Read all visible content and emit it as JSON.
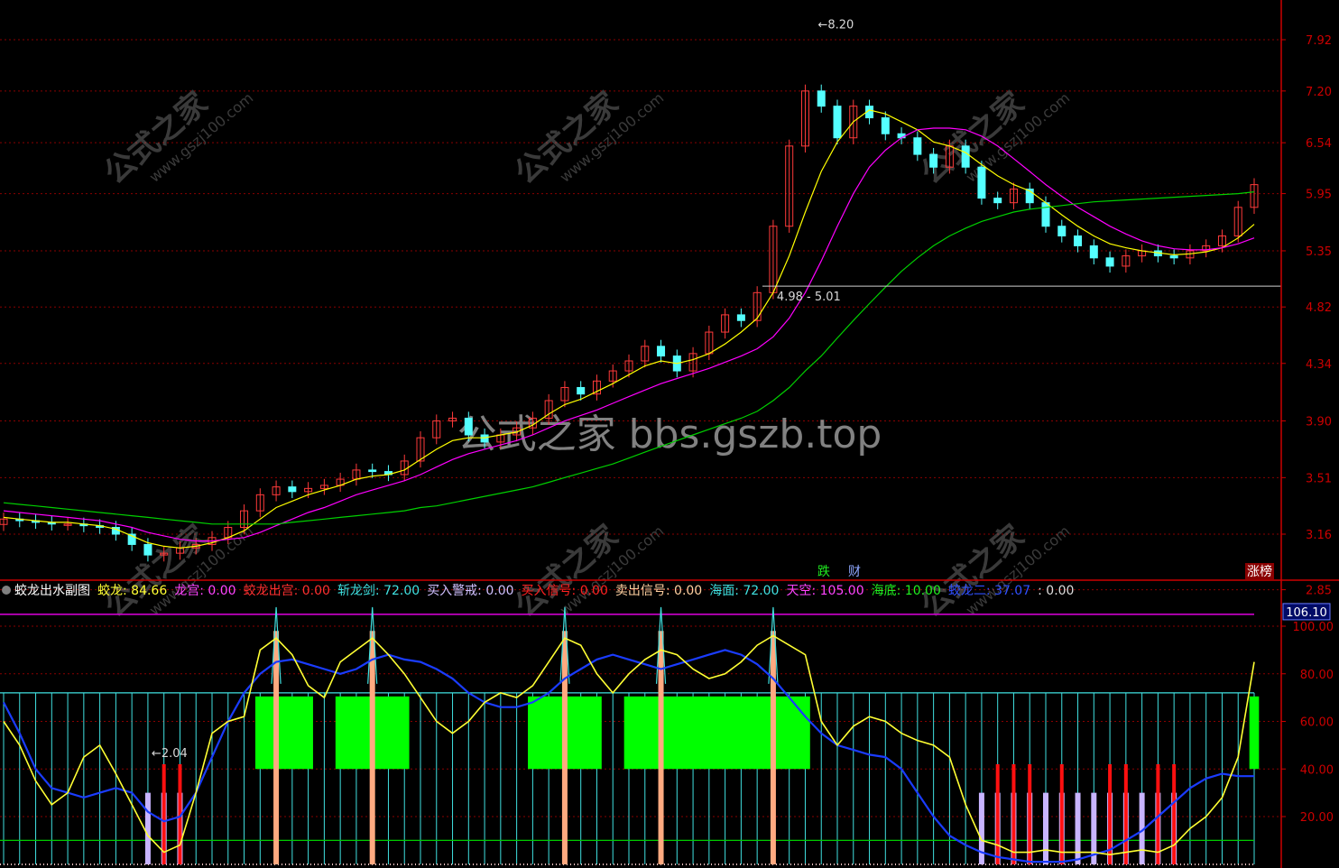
{
  "colors": {
    "background": "#000000",
    "grid": "#8a0000",
    "axis": "#cc0000",
    "up_candle": "#ff3a3a",
    "down_candle": "#54ffff",
    "ma5": "#ffffff",
    "ma10": "#ffff00",
    "ma20": "#ff00ff",
    "ma60": "#00d000",
    "jiaolong_line": "#ffff33",
    "blue_line": "#1a3cff",
    "cyan_bars": "#40e0e0",
    "green_blocks": "#00ff00",
    "orange_bars": "#ffaa80",
    "red_bars": "#ff1010",
    "lavender_bars": "#c8b4ff",
    "level_line_top": "#cc00cc",
    "level_line_low": "#00cc00"
  },
  "watermarks": {
    "big": "公式之家 bbs.gszb.top",
    "small_cn": "公式之家",
    "small_url": "www.gszj100.com"
  },
  "main_panel": {
    "high_label": "8.20",
    "low_label": "2.04",
    "ref_line_label": "4.98 - 5.01",
    "event_labels": [
      "跌",
      "财"
    ],
    "corner_label": "涨榜"
  },
  "sub_panel": {
    "title": "蛟龙出水副图",
    "items": [
      {
        "label": "蛟龙",
        "value": "84.66",
        "color": "#ffff33"
      },
      {
        "label": "龙宫",
        "value": "0.00",
        "color": "#ff44ff"
      },
      {
        "label": "蛟龙出宫",
        "value": "0.00",
        "color": "#ff3030"
      },
      {
        "label": "斩龙剑",
        "value": "72.00",
        "color": "#40e0e0"
      },
      {
        "label": "买入警戒",
        "value": "0.00",
        "color": "#d0c0ff"
      },
      {
        "label": "买入信号",
        "value": "0.00",
        "color": "#ff2020"
      },
      {
        "label": "卖出信号",
        "value": "0.00",
        "color": "#ffd0a0"
      },
      {
        "label": "海面",
        "value": "72.00",
        "color": "#40e0e0"
      },
      {
        "label": "天空",
        "value": "105.00",
        "color": "#ff44ff"
      },
      {
        "label": "海底",
        "value": "10.00",
        "color": "#20ee20"
      },
      {
        "label": "蛟龙二",
        "value": "37.07",
        "color": "#3050ff"
      },
      {
        "label": "",
        "value": "0.00",
        "color": "#dddddd"
      }
    ],
    "current_value_box": "106.10"
  },
  "chart_data": [
    {
      "type": "line",
      "panel": "price",
      "y_axis": {
        "ticks": [
          7.92,
          7.2,
          6.54,
          5.95,
          5.35,
          4.82,
          4.34,
          3.9,
          3.51,
          3.16,
          2.85
        ],
        "tick_labels": [
          "7.92",
          "7.20",
          "6.54",
          "5.95",
          "5.35",
          "4.82",
          "4.34",
          "3.90",
          "3.51",
          "3.16",
          "2.85"
        ],
        "scale": "log"
      },
      "annotations": {
        "high": 8.2,
        "low": 2.04,
        "ref_line": [
          4.98,
          5.01
        ]
      },
      "series": [
        {
          "values": [
            3.25,
            3.24,
            3.23,
            3.22,
            3.22,
            3.21,
            3.2,
            3.16,
            3.1,
            3.04,
            3.05,
            3.08,
            3.1,
            3.14,
            3.2,
            3.3,
            3.4,
            3.45,
            3.42,
            3.44,
            3.46,
            3.5,
            3.56,
            3.55,
            3.53,
            3.62,
            3.78,
            3.9,
            3.92,
            3.8,
            3.75,
            3.8,
            3.85,
            3.92,
            4.05,
            4.15,
            4.1,
            4.2,
            4.28,
            4.36,
            4.48,
            4.4,
            4.28,
            4.42,
            4.6,
            4.75,
            4.7,
            4.95,
            5.6,
            6.5,
            7.2,
            7.0,
            6.6,
            7.0,
            6.85,
            6.65,
            6.6,
            6.4,
            6.25,
            6.5,
            6.25,
            5.9,
            5.85,
            6.0,
            5.85,
            5.6,
            5.5,
            5.4,
            5.28,
            5.2,
            5.3,
            5.35,
            5.3,
            5.28,
            5.35,
            5.4,
            5.5,
            5.8,
            6.05
          ]
        },
        {
          "values": [
            3.26,
            3.25,
            3.24,
            3.23,
            3.23,
            3.22,
            3.21,
            3.19,
            3.15,
            3.11,
            3.09,
            3.08,
            3.09,
            3.11,
            3.14,
            3.18,
            3.25,
            3.32,
            3.36,
            3.4,
            3.43,
            3.46,
            3.5,
            3.52,
            3.53,
            3.56,
            3.63,
            3.7,
            3.76,
            3.78,
            3.78,
            3.8,
            3.82,
            3.87,
            3.95,
            4.02,
            4.06,
            4.12,
            4.18,
            4.25,
            4.32,
            4.36,
            4.34,
            4.37,
            4.42,
            4.5,
            4.6,
            4.72,
            4.95,
            5.3,
            5.75,
            6.2,
            6.55,
            6.8,
            6.95,
            6.9,
            6.8,
            6.7,
            6.55,
            6.5,
            6.42,
            6.28,
            6.15,
            6.05,
            5.98,
            5.85,
            5.72,
            5.6,
            5.5,
            5.42,
            5.38,
            5.35,
            5.33,
            5.31,
            5.32,
            5.34,
            5.38,
            5.48,
            5.62
          ]
        },
        {
          "values": [
            3.3,
            3.29,
            3.28,
            3.27,
            3.26,
            3.25,
            3.24,
            3.22,
            3.2,
            3.17,
            3.15,
            3.13,
            3.12,
            3.12,
            3.13,
            3.14,
            3.17,
            3.21,
            3.25,
            3.29,
            3.32,
            3.36,
            3.4,
            3.43,
            3.46,
            3.49,
            3.53,
            3.58,
            3.63,
            3.67,
            3.7,
            3.73,
            3.76,
            3.8,
            3.85,
            3.9,
            3.94,
            3.98,
            4.03,
            4.08,
            4.13,
            4.18,
            4.22,
            4.26,
            4.3,
            4.35,
            4.4,
            4.46,
            4.56,
            4.72,
            4.95,
            5.25,
            5.6,
            5.95,
            6.25,
            6.45,
            6.6,
            6.7,
            6.72,
            6.72,
            6.7,
            6.62,
            6.5,
            6.35,
            6.2,
            6.05,
            5.92,
            5.8,
            5.7,
            5.6,
            5.52,
            5.45,
            5.4,
            5.37,
            5.36,
            5.36,
            5.38,
            5.42,
            5.48
          ]
        },
        {
          "values": [
            3.35,
            3.34,
            3.33,
            3.32,
            3.31,
            3.3,
            3.29,
            3.28,
            3.27,
            3.26,
            3.25,
            3.24,
            3.23,
            3.22,
            3.22,
            3.22,
            3.22,
            3.22,
            3.23,
            3.24,
            3.25,
            3.26,
            3.27,
            3.28,
            3.29,
            3.3,
            3.32,
            3.33,
            3.35,
            3.37,
            3.39,
            3.41,
            3.43,
            3.45,
            3.48,
            3.51,
            3.54,
            3.57,
            3.6,
            3.64,
            3.68,
            3.72,
            3.76,
            3.8,
            3.84,
            3.88,
            3.92,
            3.97,
            4.05,
            4.15,
            4.28,
            4.4,
            4.55,
            4.7,
            4.85,
            5.0,
            5.15,
            5.28,
            5.4,
            5.5,
            5.58,
            5.65,
            5.7,
            5.75,
            5.78,
            5.8,
            5.82,
            5.84,
            5.86,
            5.87,
            5.88,
            5.89,
            5.9,
            5.91,
            5.92,
            5.93,
            5.94,
            5.95,
            5.97
          ]
        }
      ]
    },
    {
      "type": "line",
      "panel": "indicator",
      "y_axis": {
        "ticks": [
          100,
          80,
          60,
          40,
          20
        ],
        "tick_labels": [
          "100.00",
          "80.00",
          "60.00",
          "40.00",
          "20.00"
        ],
        "range": [
          -8,
          112
        ]
      },
      "levels": {
        "sky": 105,
        "sea_surface": 72,
        "sea_bottom": 10
      },
      "series": [
        {
          "name": "蛟龙",
          "values": [
            60,
            50,
            35,
            25,
            30,
            45,
            50,
            38,
            25,
            12,
            5,
            8,
            30,
            55,
            60,
            62,
            90,
            95,
            88,
            75,
            70,
            85,
            90,
            95,
            88,
            80,
            70,
            60,
            55,
            60,
            68,
            72,
            70,
            75,
            85,
            95,
            92,
            80,
            72,
            80,
            86,
            90,
            88,
            82,
            78,
            80,
            85,
            92,
            96,
            92,
            88,
            60,
            50,
            58,
            62,
            60,
            55,
            52,
            50,
            45,
            25,
            10,
            8,
            5,
            5,
            6,
            5,
            5,
            5,
            4,
            5,
            6,
            5,
            8,
            15,
            20,
            28,
            45,
            85
          ]
        },
        {
          "name": "蛟龙二",
          "values": [
            68,
            55,
            40,
            32,
            30,
            28,
            30,
            32,
            30,
            22,
            18,
            20,
            30,
            45,
            60,
            72,
            80,
            85,
            86,
            84,
            82,
            80,
            82,
            86,
            88,
            86,
            85,
            82,
            78,
            72,
            68,
            66,
            66,
            68,
            72,
            78,
            82,
            86,
            88,
            86,
            84,
            82,
            84,
            86,
            88,
            90,
            88,
            84,
            78,
            70,
            62,
            55,
            50,
            48,
            46,
            45,
            40,
            30,
            20,
            12,
            8,
            5,
            3,
            2,
            1,
            1,
            1,
            2,
            4,
            6,
            10,
            14,
            20,
            26,
            32,
            36,
            38,
            37,
            37
          ]
        },
        {
          "name": "斩龙剑",
          "values": [
            72,
            72,
            72,
            72,
            72,
            72,
            72,
            72,
            72,
            72,
            72,
            72,
            72,
            72,
            72,
            72,
            72,
            72,
            72,
            72,
            72,
            72,
            72,
            72,
            72,
            72,
            72,
            72,
            72,
            72,
            72,
            72,
            72,
            72,
            72,
            72,
            72,
            72,
            72,
            72,
            72,
            72,
            72,
            72,
            72,
            72,
            72,
            72,
            72,
            72,
            72,
            72,
            72,
            72,
            72,
            72,
            72,
            72,
            72,
            72,
            72,
            72,
            72,
            72,
            72,
            72,
            72,
            72,
            72,
            72,
            72,
            72,
            72,
            72,
            72,
            72,
            72,
            72,
            72
          ]
        }
      ]
    }
  ]
}
